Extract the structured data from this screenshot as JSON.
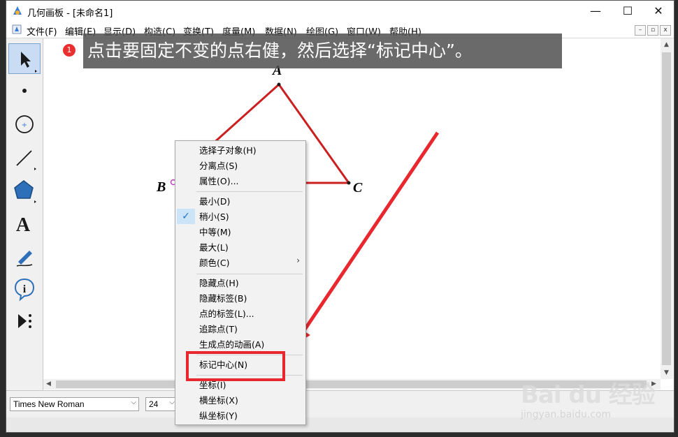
{
  "window": {
    "title": "几何画板 - [未命名1]",
    "controls": {
      "minimize": "—",
      "maximize": "☐",
      "close": "✕"
    }
  },
  "menubar": {
    "items": [
      "文件(F)",
      "编辑(E)",
      "显示(D)",
      "构造(C)",
      "变换(T)",
      "度量(M)",
      "数据(N)",
      "绘图(G)",
      "窗口(W)",
      "帮助(H)"
    ],
    "mdi": {
      "minimize": "–",
      "restore": "▫",
      "close": "x"
    }
  },
  "toolbox": {
    "tools": [
      "selection-arrow-icon",
      "point-icon",
      "compass-icon",
      "straightedge-icon",
      "polygon-icon",
      "text-icon",
      "marker-icon",
      "information-icon",
      "custom-tool-icon"
    ],
    "text_tool_glyph": "A",
    "info_tool_glyph": "i"
  },
  "canvas": {
    "points": {
      "a": "A",
      "b": "B",
      "c": "C"
    },
    "line_color": "#cc1f1f"
  },
  "annotation": {
    "step_number": "1",
    "instruction": "点击要固定不变的点右健，然后选择“标记中心”。",
    "arrow_color": "#e8282e"
  },
  "context_menu": {
    "groups": [
      [
        "选择子对象(H)",
        "分离点(S)",
        "属性(O)..."
      ],
      [
        "最小(D)",
        "稍小(S)",
        "中等(M)",
        "最大(L)",
        "颜色(C)"
      ],
      [
        "隐藏点(H)",
        "隐藏标签(B)",
        "点的标签(L)...",
        "追踪点(T)",
        "生成点的动画(A)"
      ],
      [
        "标记中心(N)"
      ],
      [
        "坐标(I)",
        "横坐标(X)",
        "纵坐标(Y)"
      ]
    ],
    "checked_item": "稍小(S)",
    "highlighted_item": "标记中心(N)",
    "submenu_arrow": "›",
    "check_mark": "✓"
  },
  "bottombar": {
    "font_name": "Times New Roman",
    "font_size": "24",
    "dropdown_arrow": "⌵"
  },
  "watermark": {
    "brand": "Bai du 经验",
    "url": "jingyan.baidu.com"
  }
}
